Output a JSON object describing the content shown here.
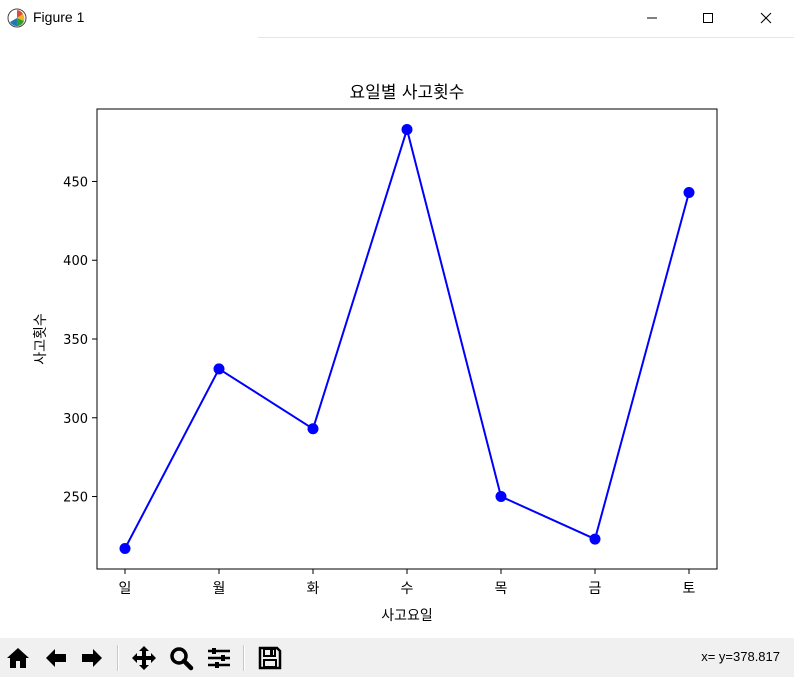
{
  "window": {
    "title": "Figure 1",
    "icons": [
      "matplotlib-logo-icon",
      "minimize-icon",
      "maximize-icon",
      "close-icon"
    ]
  },
  "toolbar": {
    "buttons": [
      "home-icon",
      "back-arrow-icon",
      "forward-arrow-icon",
      "pan-icon",
      "zoom-icon",
      "configure-subplots-icon",
      "save-icon"
    ],
    "coord_readout": "x= y=378.817"
  },
  "chart_data": {
    "type": "line",
    "title": "요일별 사고횟수",
    "xlabel": "사고요일",
    "ylabel": "사고횟수",
    "categories": [
      "일",
      "월",
      "화",
      "수",
      "목",
      "금",
      "토"
    ],
    "values": [
      217,
      331,
      293,
      483,
      250,
      223,
      443
    ],
    "ylim": [
      204,
      496
    ],
    "yticks": [
      250,
      300,
      350,
      400,
      450
    ],
    "line_color": "#0000ff",
    "marker": "circle",
    "grid": false,
    "legend": "none"
  }
}
